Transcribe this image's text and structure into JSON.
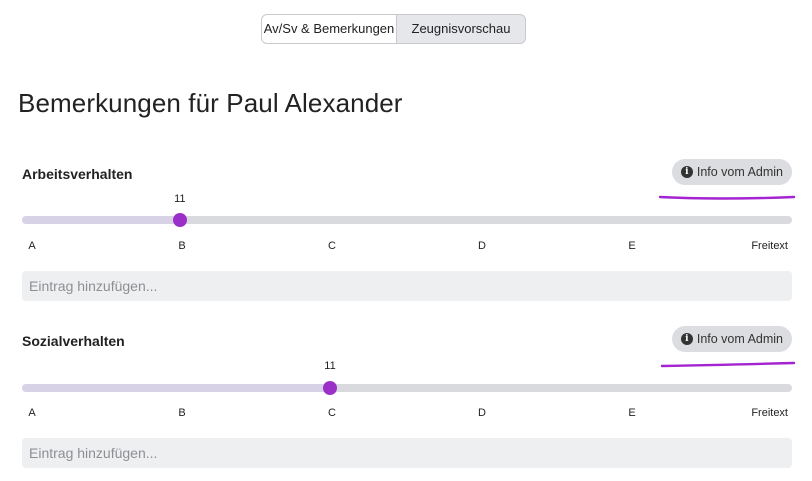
{
  "tabs": [
    {
      "label": "Av/Sv & Bemerkungen",
      "active": true
    },
    {
      "label": "Zeugnisvorschau",
      "active": false
    }
  ],
  "page_title": "Bemerkungen für Paul Alexander",
  "sections": [
    {
      "title": "Arbeitsverhalten",
      "info_label": "Info vom Admin",
      "slider_value_label": "11",
      "slider_fraction": 0.205,
      "ticks": [
        "A",
        "B",
        "C",
        "D",
        "E",
        "Freitext"
      ],
      "entry_placeholder": "Eintrag hinzufügen..."
    },
    {
      "title": "Sozialverhalten",
      "info_label": "Info vom Admin",
      "slider_value_label": "11",
      "slider_fraction": 0.4,
      "ticks": [
        "A",
        "B",
        "C",
        "D",
        "E",
        "Freitext"
      ],
      "entry_placeholder": "Eintrag hinzufügen..."
    }
  ],
  "colors": {
    "accent": "#9b30c9",
    "annotation_underline": "#a424d1",
    "track": "#d9dadd",
    "track_fill": "#d8d2e6"
  }
}
